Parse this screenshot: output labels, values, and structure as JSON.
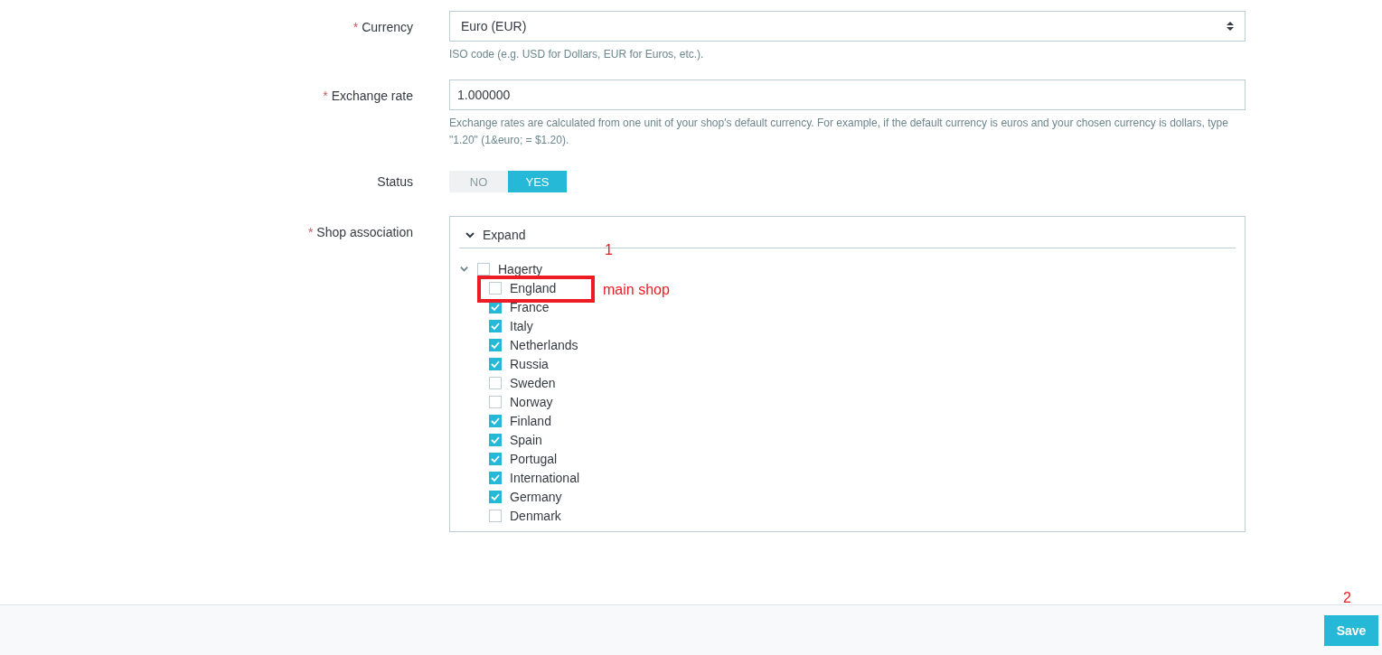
{
  "fields": [
    {
      "kind": "select",
      "label": "Currency",
      "required_mark": "*",
      "value": "Euro (EUR)",
      "hint": "ISO code (e.g. USD for Dollars, EUR for Euros, etc.)."
    },
    {
      "kind": "input",
      "label": "Exchange rate",
      "required_mark": "*",
      "value": "1.000000",
      "hint": "Exchange rates are calculated from one unit of your shop's default currency. For example, if the default currency is euros and your chosen currency is dollars, type \"1.20\" (1&euro; = $1.20)."
    },
    {
      "kind": "toggle",
      "label": "Status",
      "options": [
        {
          "label": "NO",
          "selected": false
        },
        {
          "label": "YES",
          "selected": true
        }
      ]
    },
    {
      "kind": "tree",
      "label": "Shop association",
      "required_mark": "*",
      "header": "Expand",
      "tree": [
        {
          "label": "Hagerty",
          "checked": false,
          "expanded": true,
          "children": [
            {
              "label": "England",
              "checked": false
            },
            {
              "label": "France",
              "checked": true
            },
            {
              "label": "Italy",
              "checked": true
            },
            {
              "label": "Netherlands",
              "checked": true
            },
            {
              "label": "Russia",
              "checked": true
            },
            {
              "label": "Sweden",
              "checked": false
            },
            {
              "label": "Norway",
              "checked": false
            },
            {
              "label": "Finland",
              "checked": true
            },
            {
              "label": "Spain",
              "checked": true
            },
            {
              "label": "Portugal",
              "checked": true
            },
            {
              "label": "International",
              "checked": true
            },
            {
              "label": "Germany",
              "checked": true
            },
            {
              "label": "Denmark",
              "checked": false
            }
          ]
        }
      ]
    }
  ],
  "annotations": {
    "marker_1": "1",
    "note": "main shop",
    "marker_2": "2"
  },
  "footer": {
    "save": "Save"
  }
}
